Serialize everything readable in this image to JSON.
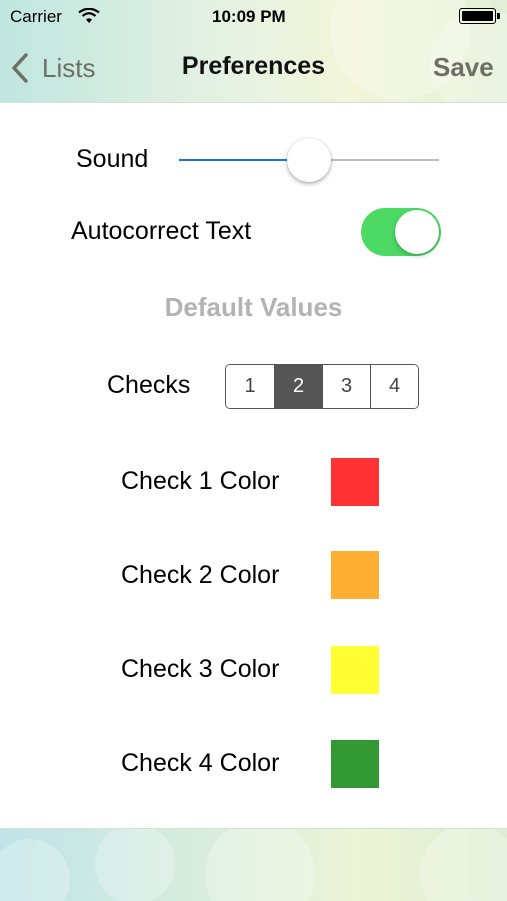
{
  "status_bar": {
    "carrier": "Carrier",
    "time": "10:09 PM"
  },
  "nav": {
    "back_label": "Lists",
    "title": "Preferences",
    "save_label": "Save"
  },
  "settings": {
    "sound_label": "Sound",
    "sound_level": 0.5,
    "autocorrect_label": "Autocorrect Text",
    "autocorrect_on": true
  },
  "defaults": {
    "header": "Default Values",
    "checks_label": "Checks",
    "checks_options": [
      "1",
      "2",
      "3",
      "4"
    ],
    "checks_selected": "2",
    "colors": [
      {
        "label": "Check 1 Color",
        "color": "#ff3333"
      },
      {
        "label": "Check 2 Color",
        "color": "#ffaf32"
      },
      {
        "label": "Check 3 Color",
        "color": "#ffff33"
      },
      {
        "label": "Check 4 Color",
        "color": "#339933"
      }
    ]
  },
  "theme": {
    "accent": "#1a73e0",
    "toggle_on": "#4cd964",
    "segment_selected": "#555555"
  }
}
